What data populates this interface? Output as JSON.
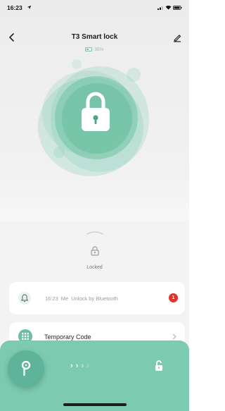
{
  "status_bar": {
    "time": "16:23"
  },
  "header": {
    "title": "T3 Smart lock",
    "battery": "35%"
  },
  "lock_status": {
    "label": "Locked"
  },
  "latest_log": {
    "time": "16:23",
    "user": "Me",
    "action": "Unlock by Bluetooth",
    "badge": "1"
  },
  "temporary_code": {
    "label": "Temporary Code"
  },
  "slider": {
    "arrows": [
      "›",
      "›",
      "›",
      "›"
    ]
  },
  "colors": {
    "accent": "#7ccab0",
    "accent_dark": "#5fb398",
    "badge": "#e0352b"
  },
  "icons": {
    "status_bar": [
      "location-arrow-icon",
      "signal-icon",
      "wifi-icon",
      "battery-icon"
    ],
    "header": [
      "back-icon",
      "edit-icon",
      "battery-icon"
    ],
    "main": [
      "padlock-icon",
      "handle-icon",
      "small-padlock-icon",
      "bell-icon",
      "grid-icon",
      "chevron-right-icon",
      "key-icon",
      "unlock-icon"
    ]
  }
}
